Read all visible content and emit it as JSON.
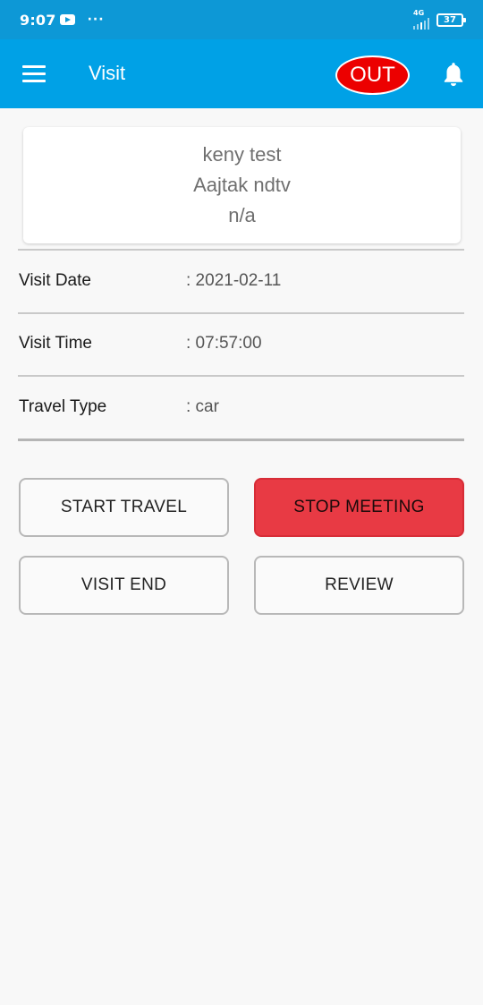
{
  "status_bar": {
    "time": "9:07",
    "dots": "···",
    "network": "4G",
    "battery": "37",
    "icons": [
      "youtube-icon",
      "signal-icon",
      "battery-icon"
    ]
  },
  "app_bar": {
    "title": "Visit",
    "out_label": "OUT",
    "background": "#00a1e6",
    "out_color": "#ec0000"
  },
  "card": {
    "line1": "keny test",
    "line2": "Aajtak ndtv",
    "line3": "n/a"
  },
  "details": [
    {
      "label": "Visit Date",
      "value": ": 2021-02-11"
    },
    {
      "label": "Visit Time",
      "value": ": 07:57:00"
    },
    {
      "label": "Travel Type",
      "value": ": car"
    }
  ],
  "buttons": {
    "start_travel": "START TRAVEL",
    "stop_meeting": "STOP MEETING",
    "visit_end": "VISIT END",
    "review": "REVIEW",
    "stop_meeting_color": "#e83a44"
  }
}
